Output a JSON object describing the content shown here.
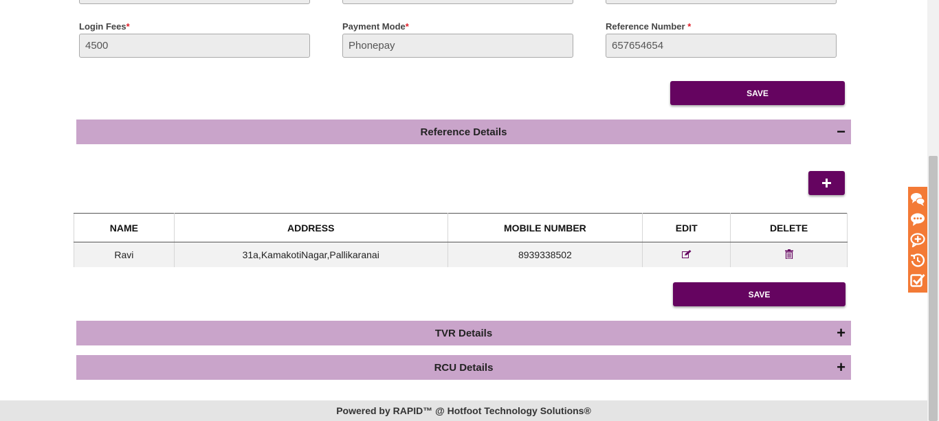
{
  "payment": {
    "login_fees": {
      "label": "Login Fees",
      "value": "4500"
    },
    "payment_mode": {
      "label": "Payment Mode",
      "value": "Phonepay"
    },
    "reference_number": {
      "label": "Reference Number ",
      "value": "657654654"
    },
    "required_marker": "*",
    "save_label": "SAVE"
  },
  "reference_section": {
    "title": "Reference Details",
    "toggle": "−",
    "add_label": "+",
    "columns": [
      "NAME",
      "ADDRESS",
      "MOBILE NUMBER",
      "EDIT",
      "DELETE"
    ],
    "rows": [
      {
        "name": "Ravi",
        "address": "31a,KamakotiNagar,Pallikaranai",
        "mobile": "8939338502"
      }
    ],
    "save_label": "SAVE"
  },
  "tvr_section": {
    "title": "TVR Details",
    "toggle": "+"
  },
  "rcu_section": {
    "title": "RCU Details",
    "toggle": "+"
  },
  "footer": {
    "text": "Powered by RAPID™ @ Hotfoot Technology Solutions®"
  },
  "side_widget": {
    "icons": [
      "chat-bubbles-icon",
      "chat-dots-icon",
      "chat-add-icon",
      "history-icon",
      "task-check-icon"
    ]
  },
  "colors": {
    "brand": "#650460",
    "section_bar": "#c9a4ca",
    "widget": "#f37a36"
  }
}
